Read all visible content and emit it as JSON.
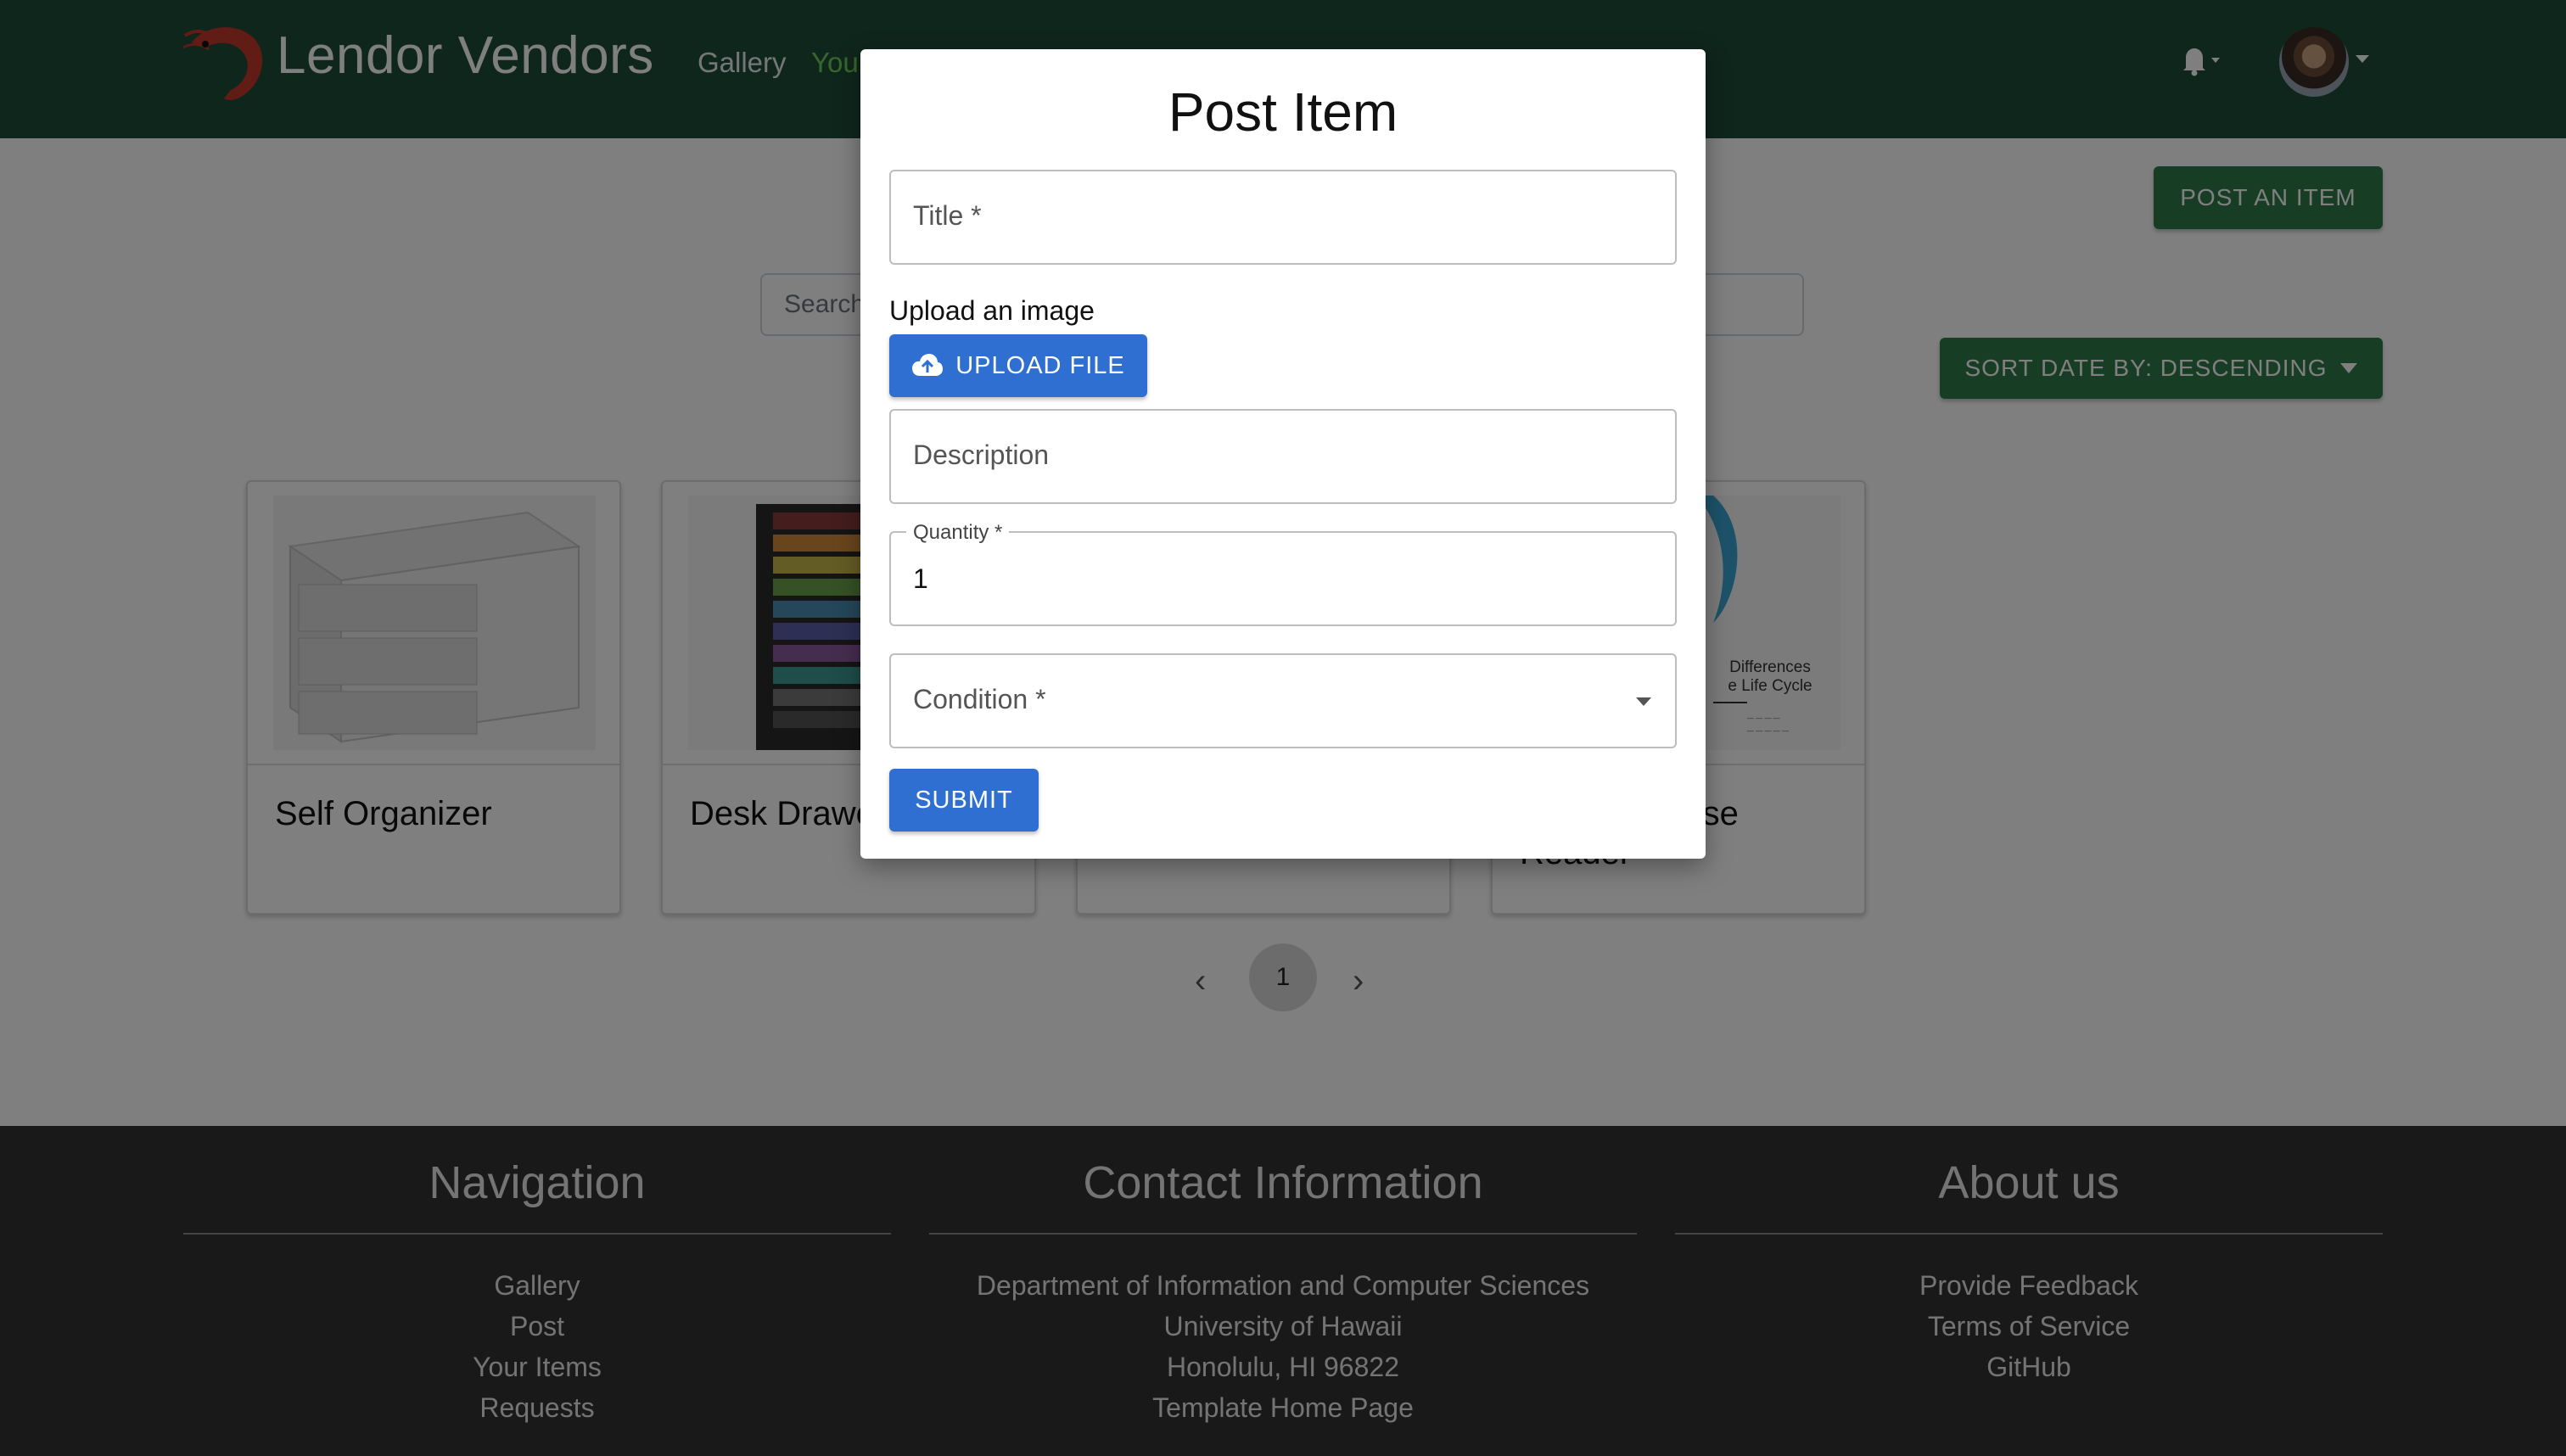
{
  "navbar": {
    "brand": "Lendor Vendors",
    "links": [
      "Gallery",
      "You"
    ],
    "accent_color": "#1f4d39"
  },
  "page": {
    "post_button": "POST AN ITEM",
    "search_placeholder": "Search",
    "sort_button": "SORT DATE BY: DESCENDING",
    "button_color": "#2e7d4a",
    "cards": [
      {
        "title": "Self Organizer"
      },
      {
        "title": "Desk Drawe"
      },
      {
        "title": ""
      },
      {
        "title": "urse",
        "title_line2": "Reader",
        "image_text": "Differences\ne Life Cycle"
      }
    ],
    "pagination": {
      "current": "1",
      "prev_icon": "chevron-left-icon",
      "next_icon": "chevron-right-icon"
    }
  },
  "footer": {
    "navigation": {
      "heading": "Navigation",
      "links": [
        "Gallery",
        "Post",
        "Your Items",
        "Requests"
      ]
    },
    "contact": {
      "heading": "Contact Information",
      "lines": [
        "Department of Information and Computer Sciences",
        "University of Hawaii",
        "Honolulu, HI 96822",
        "Template Home Page"
      ]
    },
    "about": {
      "heading": "About us",
      "links": [
        "Provide Feedback",
        "Terms of Service",
        "GitHub"
      ]
    }
  },
  "modal": {
    "title": "Post Item",
    "title_field": {
      "placeholder": "Title *"
    },
    "upload_label": "Upload an image",
    "upload_button": "UPLOAD FILE",
    "description_field": {
      "placeholder": "Description"
    },
    "quantity_field": {
      "label": "Quantity *",
      "value": "1"
    },
    "condition_field": {
      "placeholder": "Condition *",
      "icon": "chevron-down-icon"
    },
    "submit_button": "SUBMIT",
    "button_color": "#2f6fd1"
  }
}
